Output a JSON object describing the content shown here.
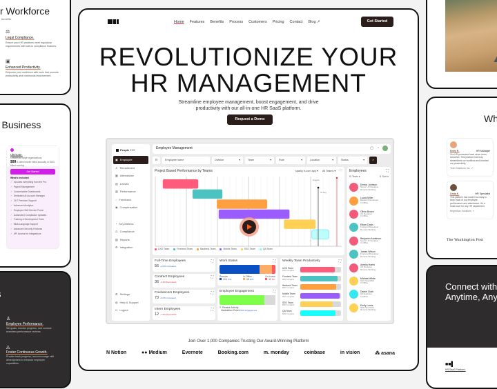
{
  "left_cards": {
    "workforce": {
      "heading": "r Workforce",
      "subtitle": "benefits.",
      "features": [
        {
          "icon": "compliance-icon",
          "title": "Legal Compliance.",
          "desc": "Ensure your HR practices meet regulatory requirements with built-in compliance features."
        },
        {
          "icon": "productivity-icon",
          "title": "Enhanced Productivity.",
          "desc": "Empower your workforce with tools that promote productivity and continuous improvement."
        }
      ]
    },
    "business": {
      "heading": "r Business",
      "plan": {
        "name": "Ultimate.",
        "desc": "Created for large organizations.",
        "price": "$99",
        "price_note": "8 users/month billed annually or $120 billed monthly",
        "cta": "Get Started",
        "included_title": "What's included",
        "items": [
          "Includes everything from the Pro",
          "Payroll Management",
          "Customizable Dashboards",
          "Dedicated AI Account Manager",
          "24/7 Premium Support",
          "Advanced Analytics",
          "Employee Self-Service Portal",
          "Automated Compliance Updates",
          "Training & Development Tools",
          "Multi-Language Support",
          "Advanced Security Features",
          "API Access for Integrations"
        ],
        "accent": "#d21ee8"
      }
    },
    "features": {
      "heading": "res",
      "items": [
        {
          "icon": "user-icon",
          "title": "Employee Performance.",
          "desc": "Set goals, monitor progress, and conduct seamless performance reviews."
        },
        {
          "icon": "growth-icon",
          "title": "Foster Continuous Growth.",
          "desc": "Provide track progress, and encourage skill development to enhance employee capabilities."
        }
      ]
    }
  },
  "right_cards": {
    "testimonials": {
      "heading": "Wh",
      "items": [
        {
          "name": "Emily R.",
          "role": "HR Manager",
          "quote": "Our HR processes have never been smoother. This platform has truly streamlined our workflow and boosted our productivity.",
          "company": "Tech Solutions Inc. ↗"
        },
        {
          "name": "Linda K.",
          "role": "HR Specialist",
          "quote": "This platform has made it so easy to keep track of our employee performance and attendance. It's a must-have for any HR department.",
          "company": "BrightStar Solutions ↗"
        }
      ],
      "press_logo": "The Washington Post"
    },
    "connect": {
      "heading_line1": "Connect with",
      "heading_line2": "Anytime, Any",
      "footer_title": "HR SaaS Platform."
    }
  },
  "nav": {
    "links": [
      "Home",
      "Features",
      "Benefits",
      "Process",
      "Customers",
      "Pricing",
      "Contact",
      "Blog ↗"
    ],
    "cta": "Get Started"
  },
  "hero": {
    "line1": "REVOLUTIONIZE YOUR",
    "line2": "HR MANAGEMENT",
    "tagline_1": "Streamline employee management, boost engagement, and drive",
    "tagline_2": "productivity with our all-in-one HR SaaS platform.",
    "cta": "Request a Demo"
  },
  "dashboard": {
    "brand": "People +++",
    "sidebar": [
      "Employee",
      "Recruitment",
      "Attendance",
      "Leaves",
      "Performance",
      "Feedback",
      "Compensation"
    ],
    "sidebar2": [
      "Key Metrics",
      "Compliance",
      "Reports",
      "Integration"
    ],
    "sidebar3": [
      "Settings",
      "Help & Support",
      "Logout"
    ],
    "title": "Employee Management",
    "filters": {
      "search_placeholder": "Employee name",
      "division": "Division",
      "team": "Team",
      "role": "Role",
      "location": "Location",
      "status": "Status"
    },
    "gantt": {
      "title": "Project Based Performance by Teams",
      "project": "sparky e-com app",
      "teams_filter": "All Teams",
      "month1": "July",
      "month2": "August",
      "marker": "31 Aug",
      "bars": [
        {
          "team": "UXD Team",
          "start": 0.04,
          "end": 0.23,
          "color": "#ff5c7c"
        },
        {
          "team": "Frontend Team",
          "start": 0.2,
          "end": 0.36,
          "color": "#4cc3c1"
        },
        {
          "team": "Backend Team",
          "start": 0.33,
          "end": 0.6,
          "color": "#ffa040"
        },
        {
          "team": "Mobile Team",
          "start": 0.34,
          "end": 0.72,
          "color": "#9b5cff"
        },
        {
          "team": "SEO Team",
          "start": 0.69,
          "end": 0.86,
          "color": "#ffd056"
        },
        {
          "team": "QA Team",
          "start": 0.84,
          "end": 0.93,
          "color": "#7ffcfc"
        }
      ]
    },
    "employees": {
      "title": "Employees",
      "team": "Team",
      "sort": "Sort",
      "list": [
        {
          "name": "Emma Johnson",
          "role": "Senior UX Designer",
          "status": "Remote Working",
          "color": "#f25c7a"
        },
        {
          "name": "Lucas Miller",
          "role": "Backend Developer",
          "status": "In Office",
          "color": "#ffa040"
        },
        {
          "name": "Olivia Brown",
          "role": "UX Designer",
          "status": "In Office",
          "color": "#f25c7a"
        },
        {
          "name": "Ethan Davis",
          "role": "Frontend Developer",
          "status": "Remote Working",
          "color": "#4cc3c1"
        },
        {
          "name": "Benjamin Anderson",
          "role": "Senior UX Designer",
          "status": "In Office",
          "color": "#f25c7a"
        },
        {
          "name": "James Wilson",
          "role": "Frontend Developer",
          "status": "Remote Working",
          "color": "#4cc3c1"
        },
        {
          "name": "Amelia Harris",
          "role": "UX Designer",
          "status": "Remote Working",
          "color": "#f25c7a"
        },
        {
          "name": "Michael White",
          "role": "SEO Specialist",
          "status": "In Office",
          "color": "#ffd056"
        },
        {
          "name": "Daniel Clark",
          "role": "QA Engineer",
          "status": "In Office",
          "color": "#35e8f0"
        },
        {
          "name": "Emily Lewis",
          "role": "SEO Specialist",
          "status": "Remote Working",
          "color": "#ffd056"
        }
      ]
    },
    "stats": [
      {
        "label": "Full-Time Employees",
        "value": "56",
        "change": "+2.5% Increased",
        "dir": "up"
      },
      {
        "label": "Contract Employees",
        "value": "36",
        "change": "-4.3% Decreased",
        "dir": "down"
      },
      {
        "label": "Freelancers Employees",
        "value": "73",
        "change": "+6.5% Increased",
        "dir": "up"
      },
      {
        "label": "Intern Employees",
        "value": "12",
        "change": "-7.5% Decreased",
        "dir": "down"
      }
    ],
    "work_status": {
      "title": "Work Status",
      "items": [
        {
          "label": "Remote",
          "value": "126",
          "pct": "72%",
          "share": 0.72,
          "color": "#0a4fc4"
        },
        {
          "label": "In-Office",
          "value": "38",
          "pct": "22%",
          "share": 0.22,
          "color": "#ffad66"
        },
        {
          "label": "On-Leave",
          "value": "12",
          "pct": "6%",
          "share": 0.06,
          "color": "#ff5a5a"
        }
      ]
    },
    "engagement": {
      "title": "Employee Engagement",
      "fill": 0.8,
      "activity_label": "Recent Activity",
      "activity_event": "Hackathon Event",
      "activity_value": "84% Engagement"
    },
    "productivity": {
      "title": "Weekly Team Productivity",
      "items": [
        {
          "team": "UXD Team",
          "label": "84% Complete",
          "value": 0.84,
          "color": "#ff5c7c"
        },
        {
          "team": "Frontend Team",
          "label": "92% Complete",
          "value": 0.92,
          "color": "#4cc3c1"
        },
        {
          "team": "Backend Team",
          "label": "88% Complete",
          "value": 0.88,
          "color": "#ffa040"
        },
        {
          "team": "Mobile Team",
          "label": "96% Complete",
          "value": 0.96,
          "color": "#9b5cff"
        },
        {
          "team": "SEO Team",
          "label": "80% Complete",
          "value": 0.8,
          "color": "#ffd056"
        },
        {
          "team": "QA Team",
          "label": "86% Complete",
          "value": 0.86,
          "color": "#19fcfc"
        }
      ]
    }
  },
  "trust": {
    "heading": "Join Over 1,000 Companies Trusting Our Award-Winning Platform",
    "logos": [
      "N Notion",
      "●● Medium",
      "Evernote",
      "Booking.com",
      "m. monday",
      "coinbase",
      "in vision",
      "⁂ asana"
    ]
  }
}
